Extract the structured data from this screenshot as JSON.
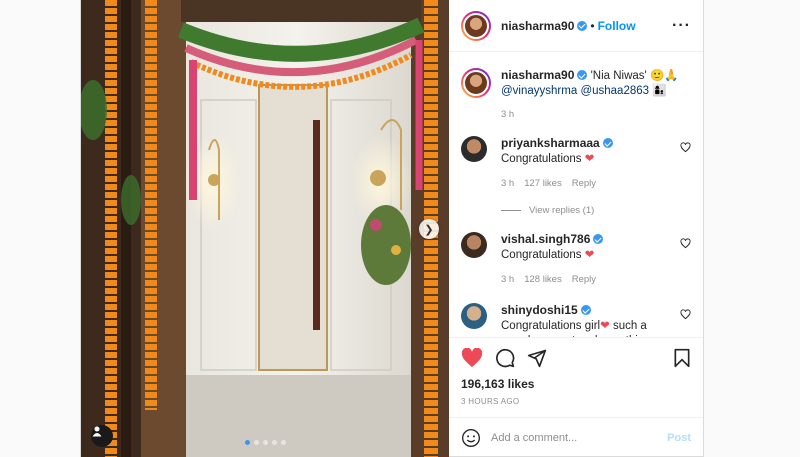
{
  "header": {
    "username": "niasharma90",
    "follow_label": "Follow",
    "separator": "•"
  },
  "caption": {
    "username": "niasharma90",
    "text": "'Nia Niwas' 🙂🙏",
    "mention1": "@vinayyshrma",
    "mention2": "@ushaa2863",
    "emoji_end": "👩‍👦",
    "time": "3 h"
  },
  "comments": [
    {
      "username": "priyanksharmaaa",
      "text": "Congratulations",
      "heart": "❤",
      "time": "3 h",
      "likes": "127 likes",
      "reply_label": "Reply",
      "view_replies": "View replies (1)"
    },
    {
      "username": "vishal.singh786",
      "text": "Congratulations",
      "heart": "❤",
      "time": "3 h",
      "likes": "128 likes",
      "reply_label": "Reply"
    },
    {
      "username": "shinydoshi15",
      "text_before": "Congratulations girl",
      "heart": "❤",
      "text_after": "such a proud moment and may this house get you all luck"
    }
  ],
  "post_stats": {
    "likes_count": "196,163",
    "likes_word": "likes",
    "time_ago": "3 HOURS AGO"
  },
  "add_comment": {
    "placeholder": "Add a comment...",
    "post_label": "Post"
  },
  "carousel": {
    "dot_count": 5,
    "active_index": 0
  },
  "colors": {
    "accent_blue": "#0095f6",
    "heart_red": "#ed4956",
    "verified": "#3897f0"
  },
  "icons": {
    "like": "heart-filled-icon",
    "comment": "speech-bubble-icon",
    "share": "paper-plane-icon",
    "save": "bookmark-icon",
    "emoji": "smiley-icon",
    "more": "ellipsis-icon",
    "next": "chevron-right-icon",
    "tag": "user-tag-icon"
  }
}
